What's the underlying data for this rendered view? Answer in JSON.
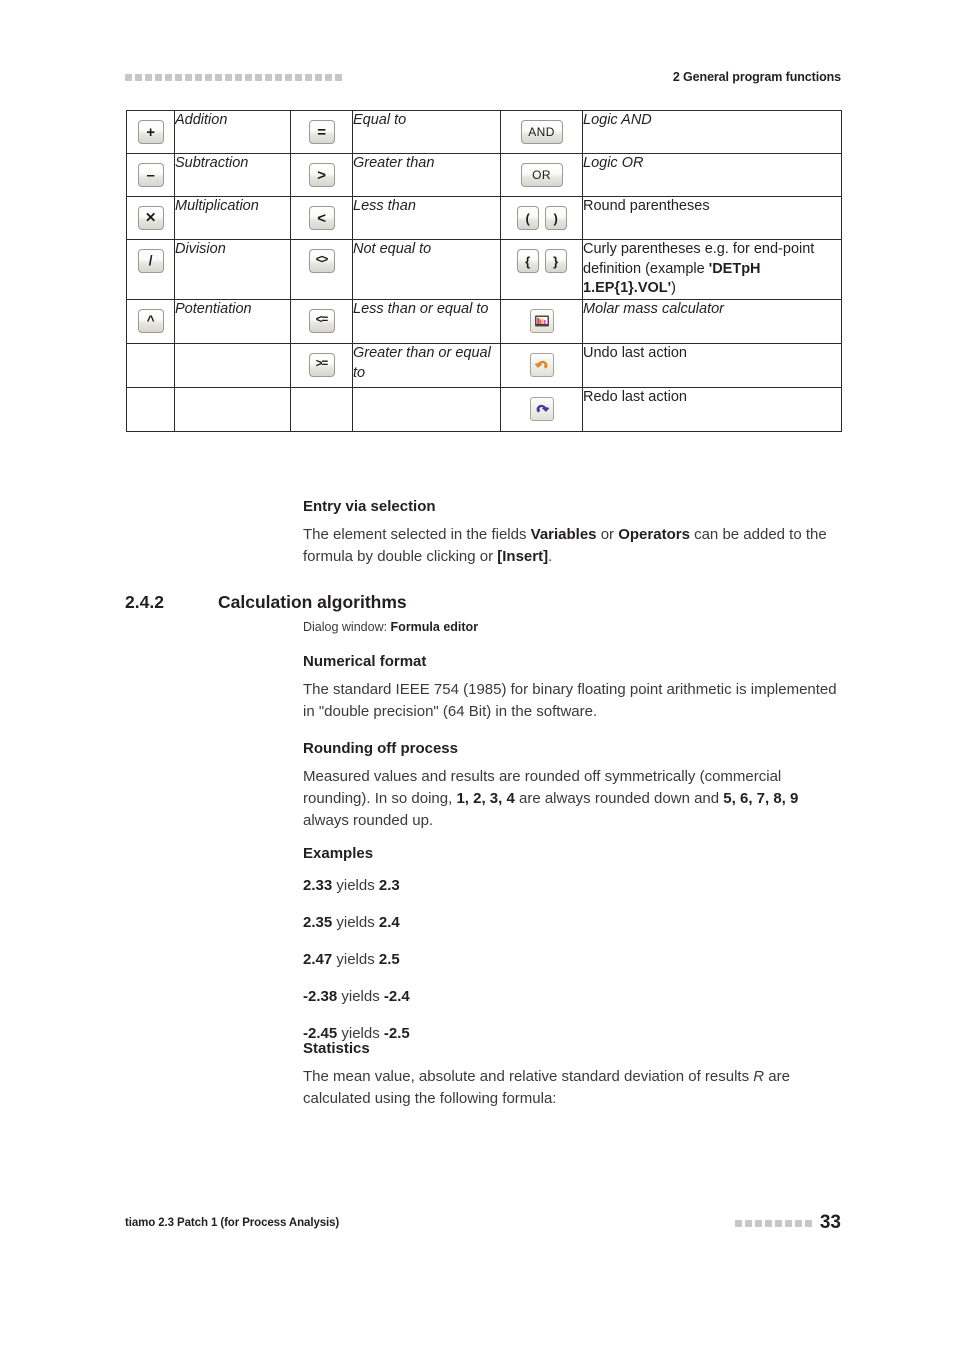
{
  "header": {
    "rule_dots": 22,
    "title": "2 General program functions"
  },
  "symbol_table": {
    "rows": [
      {
        "col1_icon": "plus-icon",
        "col1_glyph": "+",
        "col1_label": "Addition",
        "col2_icon": "equals-icon",
        "col2_glyph": "=",
        "col2_label": "Equal to",
        "col3_icon": "logic-and-icon",
        "col3_glyph": "AND",
        "col3_label": "Logic AND",
        "col3_italic": true
      },
      {
        "col1_icon": "minus-icon",
        "col1_glyph": "–",
        "col1_label": "Subtraction",
        "col2_icon": "greater-than-icon",
        "col2_glyph": ">",
        "col2_label": "Greater than",
        "col3_icon": "logic-or-icon",
        "col3_glyph": "OR",
        "col3_label": "Logic OR",
        "col3_italic": true
      },
      {
        "col1_icon": "multiply-icon",
        "col1_glyph": "✕",
        "col1_label": "Multiplication",
        "col2_icon": "less-than-icon",
        "col2_glyph": "<",
        "col2_label": "Less than",
        "col3_icon": "round-parentheses-icon",
        "col3_glyph": "(",
        "col3_glyph_b": ")",
        "col3_label": "Round parentheses",
        "col3_italic": false
      },
      {
        "col1_icon": "divide-icon",
        "col1_glyph": "/",
        "col1_label": "Division",
        "col2_icon": "not-equal-icon",
        "col2_glyph": "<>",
        "col2_label": "Not equal to",
        "col3_icon": "curly-parentheses-icon",
        "col3_glyph": "{",
        "col3_glyph_b": "}",
        "col3_label_pre": "Curly parentheses e.g. for end-point definition (example ",
        "col3_label_bold": "'DETpH 1.EP{1}.VOL'",
        "col3_label_post": ")",
        "col3_italic": false
      },
      {
        "col1_icon": "power-icon",
        "col1_glyph": "^",
        "col1_label": "Potentiation",
        "col2_icon": "less-than-or-equal-icon",
        "col2_glyph": "<=",
        "col2_label": "Less than or equal to",
        "col3_icon": "molar-mass-calculator-icon",
        "col3_label": "Molar mass calculator",
        "col3_italic": true
      },
      {
        "col1_icon": "",
        "col1_glyph": "",
        "col1_label": "",
        "col2_icon": "greater-than-or-equal-icon",
        "col2_glyph": ">=",
        "col2_label": "Greater than or equal to",
        "col3_icon": "undo-icon",
        "col3_label": "Undo last action",
        "col3_italic": false
      },
      {
        "col1_icon": "",
        "col1_glyph": "",
        "col1_label": "",
        "col2_icon": "",
        "col2_glyph": "",
        "col2_label": "",
        "col3_icon": "redo-icon",
        "col3_label": "Redo last action",
        "col3_italic": false
      }
    ]
  },
  "entry_via_selection": {
    "heading": "Entry via selection",
    "text_1": "The element selected in the fields ",
    "bold_1": "Variables",
    "text_2": " or ",
    "bold_2": "Operators",
    "text_3": " can be added to the formula by double clicking or ",
    "bold_3": "[Insert]",
    "text_4": "."
  },
  "section": {
    "number": "2.4.2",
    "title": "Calculation algorithms",
    "dialog_prefix": "Dialog window: ",
    "dialog_name": "Formula editor"
  },
  "numerical_format": {
    "heading": "Numerical format",
    "body": "The standard IEEE 754 (1985) for binary floating point arithmetic is implemented in \"double precision\" (64 Bit) in the software."
  },
  "rounding": {
    "heading": "Rounding off process",
    "text_1": "Measured values and results are rounded off symmetrically (commercial rounding). In so doing, ",
    "bold_1": "1, 2, 3, 4",
    "text_2": " are always rounded down and ",
    "bold_2": "5, 6, 7, 8, 9",
    "text_3": " always rounded up."
  },
  "examples": {
    "heading": "Examples",
    "items": [
      {
        "input": "2.33",
        "verb": " yields ",
        "output": "2.3"
      },
      {
        "input": "2.35",
        "verb": " yields ",
        "output": "2.4"
      },
      {
        "input": "2.47",
        "verb": " yields ",
        "output": "2.5"
      },
      {
        "input": "-2.38",
        "verb": " yields ",
        "output": "-2.4"
      },
      {
        "input": "-2.45",
        "verb": " yields ",
        "output": "-2.5"
      }
    ]
  },
  "statistics": {
    "heading": "Statistics",
    "text_1": "The mean value, absolute and relative standard deviation of results ",
    "italic_1": "R",
    "text_2": " are calculated using the following formula:"
  },
  "footer": {
    "left": "tiamo 2.3 Patch 1 (for Process Analysis)",
    "rule_dots": 8,
    "page_number": "33"
  },
  "colors": {
    "rule_gray": "#c6c7c8",
    "text": "#231f20",
    "body_text": "#3a3a3a",
    "undo_orange": "#e8891f",
    "redo_blue": "#3b3fa8"
  }
}
